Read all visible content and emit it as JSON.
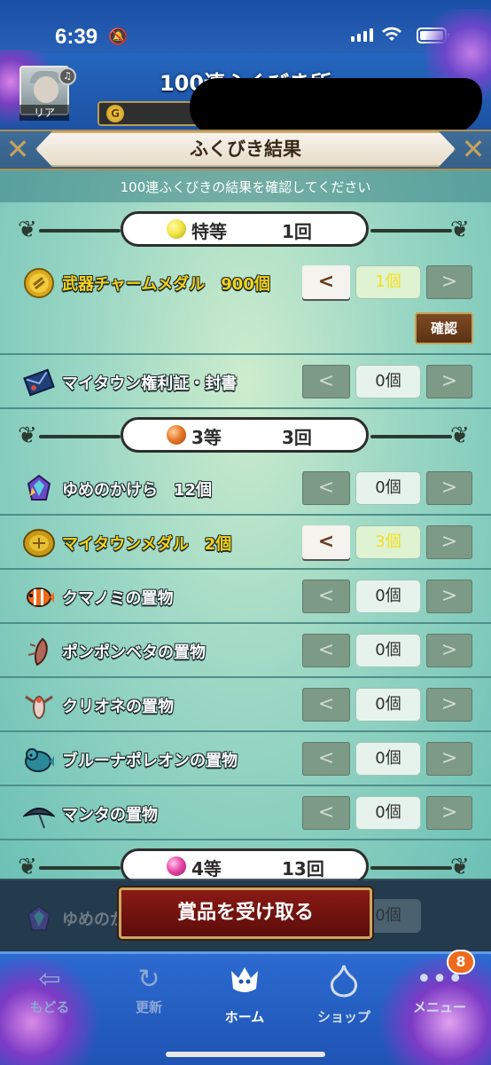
{
  "status_bar": {
    "time": "6:39"
  },
  "header": {
    "title": "100連ふくびき所",
    "avatar_name": "リア",
    "gold_icon": "G"
  },
  "result": {
    "title": "ふくびき結果",
    "subtitle": "100連ふくびきの結果を確認してください"
  },
  "sections": [
    {
      "rank": "特等",
      "count": "1回",
      "orb_color": "#f2e64a",
      "items": [
        {
          "name": "武器チャームメダル　900個",
          "qty": "1個",
          "highlight": true,
          "icon": "gold-medal-icon"
        },
        {
          "name": "マイタウン権利証・封書",
          "qty": "0個",
          "highlight": false,
          "icon": "deed-envelope-icon"
        }
      ],
      "confirm_label": "確認"
    },
    {
      "rank": "3等",
      "count": "3回",
      "orb_color": "#e87a2a",
      "items": [
        {
          "name": "ゆめのかけら　12個",
          "qty": "0個",
          "highlight": false,
          "icon": "dream-shard-icon"
        },
        {
          "name": "マイタウンメダル　2個",
          "qty": "3個",
          "highlight": true,
          "icon": "town-medal-icon"
        },
        {
          "name": "クマノミの置物",
          "qty": "0個",
          "highlight": false,
          "icon": "clownfish-icon"
        },
        {
          "name": "ポンポンベタの置物",
          "qty": "0個",
          "highlight": false,
          "icon": "betta-icon"
        },
        {
          "name": "クリオネの置物",
          "qty": "0個",
          "highlight": false,
          "icon": "clione-icon"
        },
        {
          "name": "ブルーナポレオンの置物",
          "qty": "0個",
          "highlight": false,
          "icon": "napoleon-fish-icon"
        },
        {
          "name": "マンタの置物",
          "qty": "0個",
          "highlight": false,
          "icon": "manta-icon"
        }
      ]
    },
    {
      "rank": "4等",
      "count": "13回",
      "orb_color": "#e84aa8",
      "items": [
        {
          "name": "ゆめのか",
          "qty": "0個",
          "icon": "dream-shard-icon"
        }
      ]
    }
  ],
  "buttons": {
    "prev_glyph": "<",
    "next_glyph": ">",
    "claim_label": "賞品を受け取る"
  },
  "nav": {
    "items": [
      {
        "label": "もどる",
        "icon": "back-arrow-icon"
      },
      {
        "label": "更新",
        "icon": "refresh-icon"
      },
      {
        "label": "ホーム",
        "icon": "home-dragon-icon"
      },
      {
        "label": "ショップ",
        "icon": "slime-shop-icon"
      },
      {
        "label": "メニュー",
        "icon": "menu-dots-icon"
      }
    ],
    "menu_badge": "8"
  }
}
